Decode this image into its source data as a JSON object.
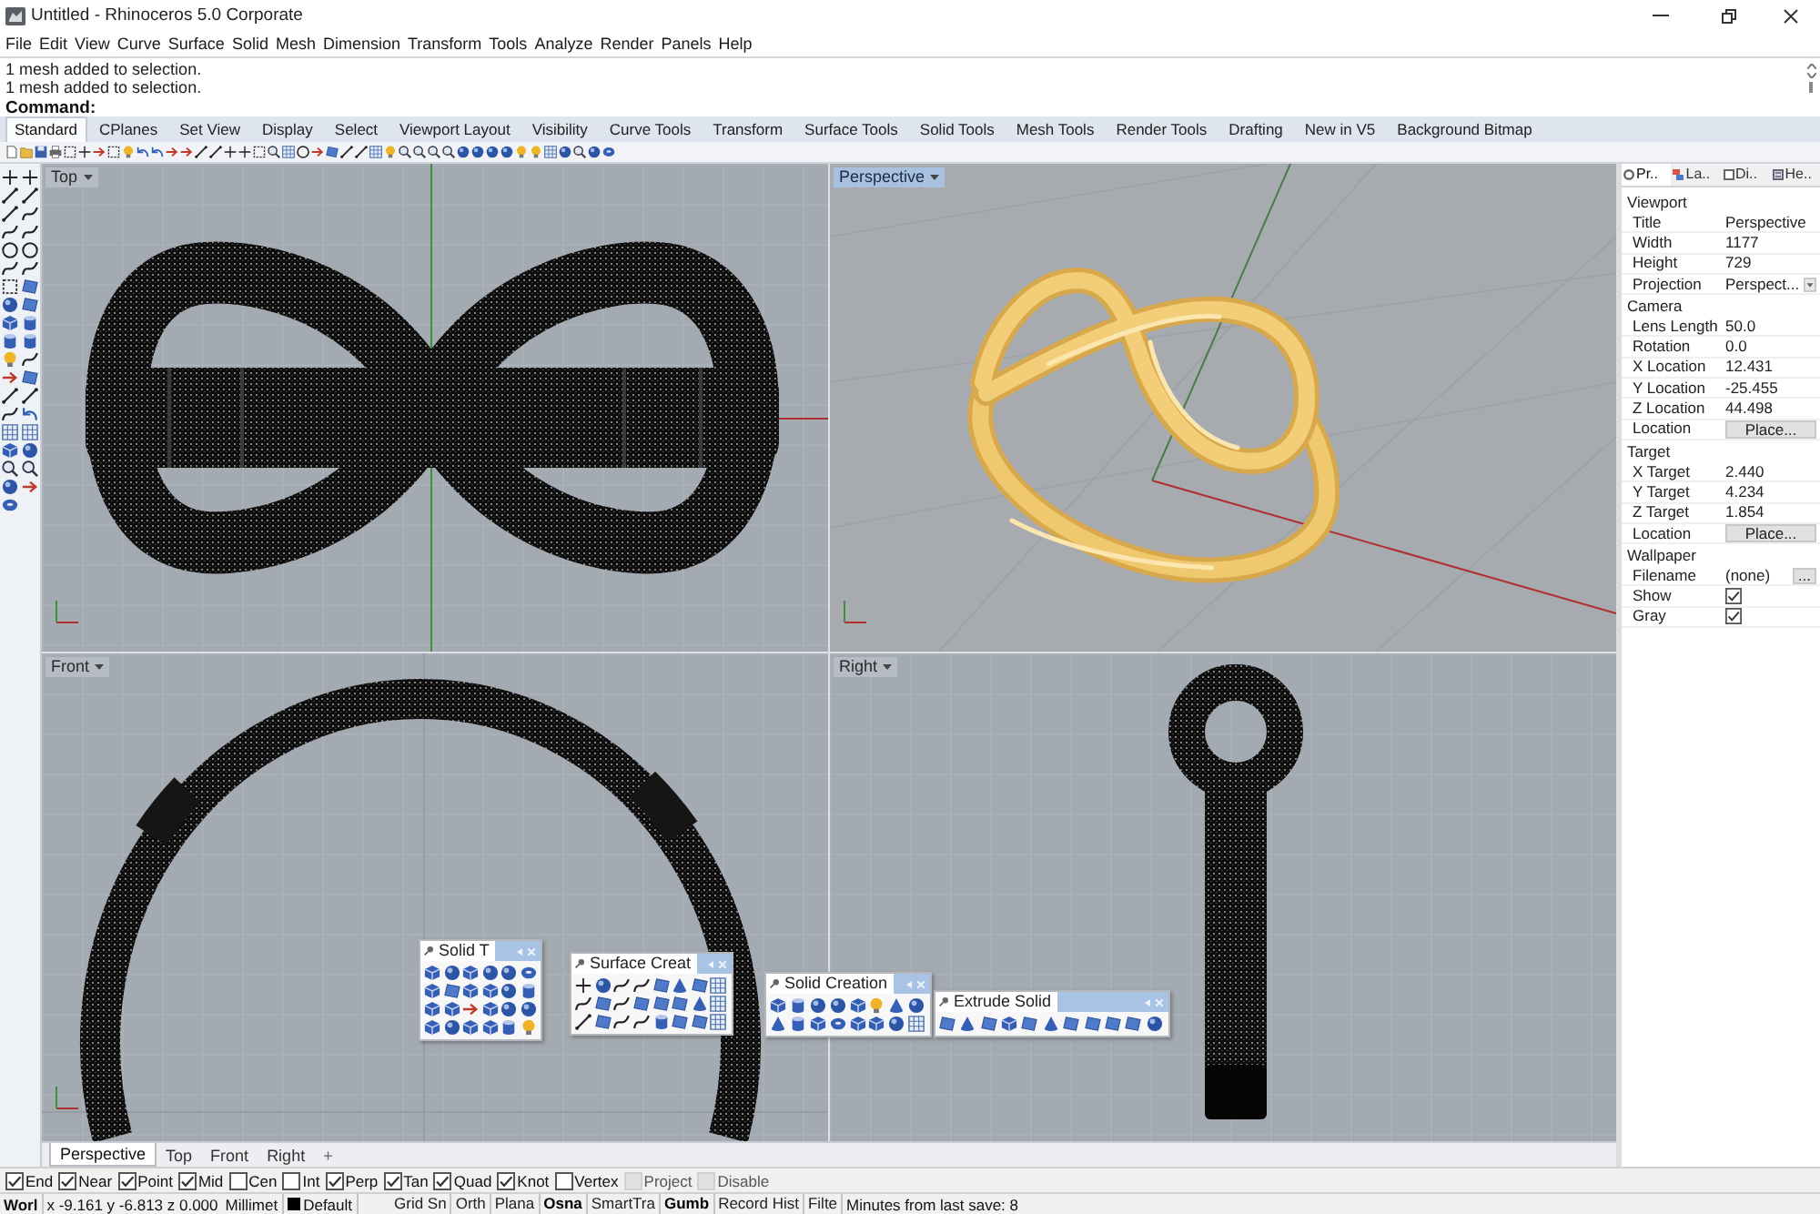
{
  "window": {
    "title": "Untitled - Rhinoceros 5.0 Corporate"
  },
  "menu": [
    "File",
    "Edit",
    "View",
    "Curve",
    "Surface",
    "Solid",
    "Mesh",
    "Dimension",
    "Transform",
    "Tools",
    "Analyze",
    "Render",
    "Panels",
    "Help"
  ],
  "command_history": [
    "1 mesh added to selection.",
    "1 mesh added to selection."
  ],
  "command_prompt": "Command:",
  "toolbar_tabs": [
    {
      "label": "Standard",
      "selected": true
    },
    {
      "label": "CPlanes",
      "selected": false
    },
    {
      "label": "Set View",
      "selected": false
    },
    {
      "label": "Display",
      "selected": false
    },
    {
      "label": "Select",
      "selected": false
    },
    {
      "label": "Viewport Layout",
      "selected": false
    },
    {
      "label": "Visibility",
      "selected": false
    },
    {
      "label": "Curve Tools",
      "selected": false
    },
    {
      "label": "Transform",
      "selected": false
    },
    {
      "label": "Surface Tools",
      "selected": false
    },
    {
      "label": "Solid Tools",
      "selected": false
    },
    {
      "label": "Mesh Tools",
      "selected": false
    },
    {
      "label": "Render Tools",
      "selected": false
    },
    {
      "label": "Drafting",
      "selected": false
    },
    {
      "label": "New in V5",
      "selected": false
    },
    {
      "label": "Background Bitmap",
      "selected": false
    }
  ],
  "viewports": [
    {
      "title": "Top",
      "kind": "top",
      "active": false
    },
    {
      "title": "Perspective",
      "kind": "perspective",
      "active": true
    },
    {
      "title": "Front",
      "kind": "front",
      "active": false
    },
    {
      "title": "Right",
      "kind": "right",
      "active": false
    }
  ],
  "floating_toolbars": [
    {
      "title": "Solid T"
    },
    {
      "title": "Surface Creat"
    },
    {
      "title": "Solid Creation"
    },
    {
      "title": "Extrude Solid"
    }
  ],
  "viewport_tabs": {
    "tabs": [
      {
        "label": "Perspective",
        "selected": true
      },
      {
        "label": "Top",
        "selected": false
      },
      {
        "label": "Front",
        "selected": false
      },
      {
        "label": "Right",
        "selected": false
      }
    ],
    "add": "+"
  },
  "properties": {
    "tabs": [
      {
        "label": "Pr..",
        "selected": true
      },
      {
        "label": "La..",
        "selected": false
      },
      {
        "label": "Di..",
        "selected": false
      },
      {
        "label": "He..",
        "selected": false
      }
    ],
    "sections": [
      {
        "title": "Viewport",
        "rows": [
          {
            "label": "Title",
            "kind": "text",
            "value": "Perspective"
          },
          {
            "label": "Width",
            "kind": "text",
            "value": "1177"
          },
          {
            "label": "Height",
            "kind": "text",
            "value": "729"
          },
          {
            "label": "Projection",
            "kind": "dropdown",
            "value": "Perspect..."
          }
        ]
      },
      {
        "title": "Camera",
        "rows": [
          {
            "label": "Lens Length",
            "kind": "text",
            "value": "50.0"
          },
          {
            "label": "Rotation",
            "kind": "text",
            "value": "0.0"
          },
          {
            "label": "X Location",
            "kind": "text",
            "value": "12.431"
          },
          {
            "label": "Y Location",
            "kind": "text",
            "value": "-25.455"
          },
          {
            "label": "Z Location",
            "kind": "text",
            "value": "44.498"
          },
          {
            "label": "Location",
            "kind": "button",
            "value": "Place..."
          }
        ]
      },
      {
        "title": "Target",
        "rows": [
          {
            "label": "X Target",
            "kind": "text",
            "value": "2.440"
          },
          {
            "label": "Y Target",
            "kind": "text",
            "value": "4.234"
          },
          {
            "label": "Z Target",
            "kind": "text",
            "value": "1.854"
          },
          {
            "label": "Location",
            "kind": "button",
            "value": "Place..."
          }
        ]
      },
      {
        "title": "Wallpaper",
        "rows": [
          {
            "label": "Filename",
            "kind": "browse",
            "value": "(none)",
            "button": "..."
          },
          {
            "label": "Show",
            "kind": "checkbox",
            "checked": true
          },
          {
            "label": "Gray",
            "kind": "checkbox",
            "checked": true
          }
        ]
      }
    ]
  },
  "osnaps": [
    {
      "label": "End",
      "checked": true,
      "disabled": false
    },
    {
      "label": "Near",
      "checked": true,
      "disabled": false
    },
    {
      "label": "Point",
      "checked": true,
      "disabled": false
    },
    {
      "label": "Mid",
      "checked": true,
      "disabled": false
    },
    {
      "label": "Cen",
      "checked": false,
      "disabled": false
    },
    {
      "label": "Int",
      "checked": false,
      "disabled": false
    },
    {
      "label": "Perp",
      "checked": true,
      "disabled": false
    },
    {
      "label": "Tan",
      "checked": true,
      "disabled": false
    },
    {
      "label": "Quad",
      "checked": true,
      "disabled": false
    },
    {
      "label": "Knot",
      "checked": true,
      "disabled": false
    },
    {
      "label": "Vertex",
      "checked": false,
      "disabled": false
    },
    {
      "label": "Project",
      "checked": false,
      "disabled": true
    },
    {
      "label": "Disable",
      "checked": false,
      "disabled": true
    }
  ],
  "status_bar": {
    "cplane": "Worl",
    "coordinates": "x -9.161 y -6.813 z 0.000",
    "units": "Millimet",
    "layer": "Default",
    "panes": [
      {
        "label": "Grid Sn",
        "on": false
      },
      {
        "label": "Orth",
        "on": false
      },
      {
        "label": "Plana",
        "on": false
      },
      {
        "label": "Osna",
        "on": true
      },
      {
        "label": "SmartTra",
        "on": false
      },
      {
        "label": "Gumb",
        "on": true
      },
      {
        "label": "Record Hist",
        "on": false
      },
      {
        "label": "Filte",
        "on": false
      }
    ],
    "message": "Minutes from last save: 8"
  }
}
